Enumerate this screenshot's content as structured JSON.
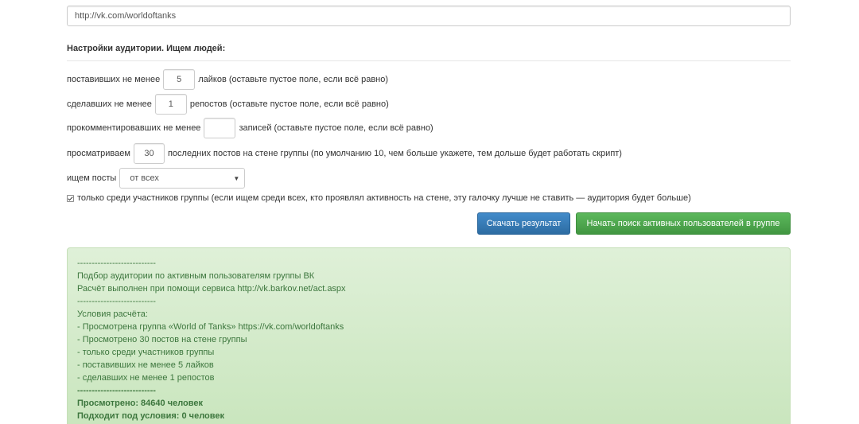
{
  "url_field": {
    "value": "http://vk.com/worldoftanks"
  },
  "audience": {
    "title": "Настройки аудитории. Ищем людей:",
    "likes": {
      "prefix": "поставивших не менее",
      "value": "5",
      "suffix": "лайков (оставьте пустое поле, если всё равно)"
    },
    "reposts": {
      "prefix": "сделавших не менее",
      "value": "1",
      "suffix": "репостов (оставьте пустое поле, если всё равно)"
    },
    "comments": {
      "prefix": "прокомментировавших не менее",
      "value": "",
      "suffix": "записей (оставьте пустое поле, если всё равно)"
    },
    "posts": {
      "prefix": "просматриваем",
      "value": "30",
      "suffix": "последних постов на стене группы (по умолчанию 10, чем больше укажете, тем дольше будет работать скрипт)"
    },
    "post_filter": {
      "label": "ищем посты",
      "selected": "от всех"
    },
    "members_only": {
      "checked": true,
      "label": "только среди участников группы (если ищем среди всех, кто проявлял активность на стене, эту галочку лучше не ставить — аудитория будет больше)"
    }
  },
  "buttons": {
    "download": "Скачать результат",
    "start": "Начать поиск активных пользователей в группе"
  },
  "result": {
    "lines": [
      "---------------------------",
      "Подбор аудитории по активным пользователям группы ВК",
      "Расчёт выполнен при помощи сервиса http://vk.barkov.net/act.aspx",
      "---------------------------",
      "Условия расчёта:",
      "- Просмотрена группа «World of Tanks» https://vk.com/worldoftanks",
      "- Просмотрено 30 постов на стене группы",
      "- только среди участников группы",
      "- поставивших не менее 5 лайков",
      "- сделавших не менее 1 репостов",
      "---------------------------",
      "Просмотрено: 84640 человек",
      "Подходит под условия: 0 человек"
    ]
  },
  "colors": {
    "primary_button": "#428bca",
    "success_button": "#5cb85c",
    "result_background": "#dff0d8",
    "result_text": "#3c763d"
  }
}
